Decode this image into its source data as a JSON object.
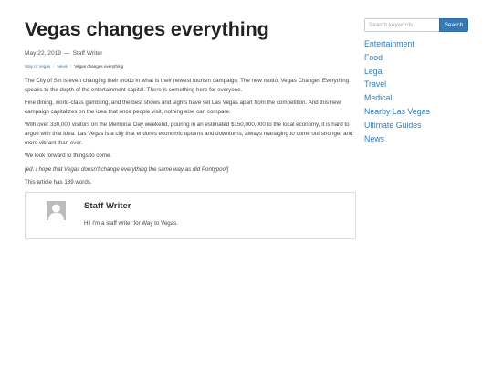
{
  "article": {
    "title": "Vegas changes everything",
    "date": "May 22, 2019",
    "meta_sep": "—",
    "author": "Staff Writer",
    "breadcrumb": {
      "home": "Way to Vegas",
      "sep": "/",
      "category": "News",
      "current": "Vegas changes everything"
    },
    "paragraphs": [
      "The City of Sin is even changing their motto in what is their newest tourism campaign. The new motto, Vegas Changes Everything speaks to the depth of the entertainment capital. There is something here for everyone.",
      "Fine dining, world-class gambling, and the best shows and sights have set Las Vegas apart from the competition. And this new campaign capitalizes on the idea that once people visit, nothing else can compare.",
      "With over 330,000 visitors on the Memorial Day weekend, pouring in an estimated $150,000,000 to the local economy, it is hard to argue with that idea. Las Vegas is a city that endures economic upturns and downturns, always managing to come out stronger and more vibrant than ever.",
      "We look forward to things to come."
    ],
    "editor_note": "[ed. I hope that Vegas doesn't change everything the same way as did Pontypool]",
    "word_count": "This article has 139 words."
  },
  "author_box": {
    "name": "Staff Writer",
    "bio": "Hi! I'm a staff writer for Way to Vegas."
  },
  "sidebar": {
    "search": {
      "placeholder": "Search keywords",
      "button_label": "Search"
    },
    "categories": [
      "Entertainment",
      "Food",
      "Legal",
      "Travel",
      "Medical",
      "Nearby Las Vegas",
      "Ultimate Guides",
      "News"
    ]
  },
  "colors": {
    "link": "#337ab7",
    "button": "#337ab7",
    "avatar": "#bcbcbc"
  }
}
